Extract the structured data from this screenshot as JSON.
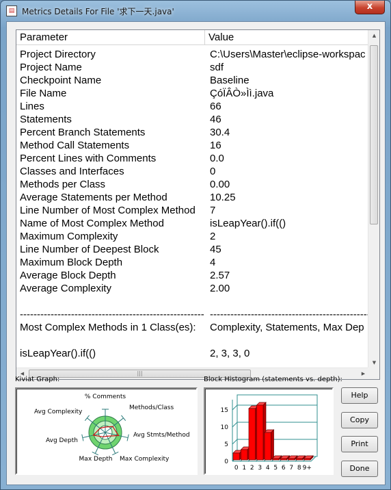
{
  "window": {
    "title": "Metrics Details For File '求下一天.java'",
    "close_glyph": "x"
  },
  "table": {
    "columns": [
      "Parameter",
      "Value"
    ],
    "rows": [
      [
        "Project Directory",
        "C:\\Users\\Master\\eclipse-workspac"
      ],
      [
        "Project Name",
        "sdf"
      ],
      [
        "Checkpoint Name",
        "Baseline"
      ],
      [
        "File Name",
        "ÇóÏÂÒ»Ìì.java"
      ],
      [
        "Lines",
        "66"
      ],
      [
        "Statements",
        "46"
      ],
      [
        "Percent Branch Statements",
        "30.4"
      ],
      [
        "Method Call Statements",
        "16"
      ],
      [
        "Percent Lines with Comments",
        "0.0"
      ],
      [
        "Classes and Interfaces",
        "0"
      ],
      [
        "Methods per Class",
        "0.00"
      ],
      [
        "Average Statements per Method",
        "10.25"
      ],
      [
        "Line Number of Most Complex Method",
        "7"
      ],
      [
        "Name of Most Complex Method",
        "isLeapYear().if(()"
      ],
      [
        "Maximum Complexity",
        "2"
      ],
      [
        "Line Number of Deepest Block",
        "45"
      ],
      [
        "Maximum Block Depth",
        "4"
      ],
      [
        "Average Block Depth",
        "2.57"
      ],
      [
        "Average Complexity",
        "2.00"
      ],
      [
        "",
        ""
      ],
      [
        "----------------------------------------------------------------",
        "------------------------------------------------------"
      ],
      [
        "Most Complex Methods in 1 Class(es):",
        "Complexity, Statements, Max Dep"
      ],
      [
        "",
        ""
      ],
      [
        "isLeapYear().if(()",
        "2, 3, 3, 0"
      ]
    ]
  },
  "kiviat": {
    "label": "Kiviat Graph:",
    "axes": [
      "% Comments",
      "Methods/Class",
      "Avg Stmts/Method",
      "Max Complexity",
      "Max Depth",
      "Avg Depth",
      "Avg Complexity"
    ]
  },
  "histogram": {
    "label": "Block Histogram (statements vs. depth):",
    "y_ticks": [
      "0",
      "5",
      "10",
      "15"
    ],
    "x_ticks": [
      "0",
      "1",
      "2",
      "3",
      "4",
      "5",
      "6",
      "7",
      "8",
      "9+"
    ]
  },
  "chart_data": {
    "type": "bar",
    "title": "Block Histogram (statements vs. depth):",
    "categories": [
      "0",
      "1",
      "2",
      "3",
      "4",
      "5",
      "6",
      "7",
      "8",
      "9+"
    ],
    "values": [
      2,
      3,
      15,
      16,
      8,
      0,
      0,
      0,
      0,
      0
    ],
    "ylim": [
      0,
      18
    ],
    "bar_color": "#ff0000"
  },
  "buttons": {
    "help": "Help",
    "copy": "Copy",
    "print": "Print",
    "done": "Done"
  },
  "scroll": {
    "up": "▲",
    "down": "▼",
    "left": "◀",
    "right": "▶",
    "grip": "|||"
  }
}
